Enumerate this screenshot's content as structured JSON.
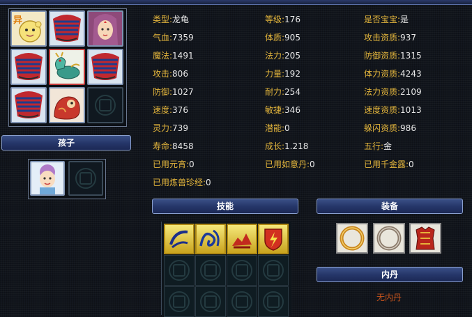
{
  "pets_header": "孩子",
  "pet_grid": {
    "badge": "异"
  },
  "stats": {
    "col1": [
      {
        "label": "类型:",
        "value": "龙龟"
      },
      {
        "label": "气血:",
        "value": "7359"
      },
      {
        "label": "魔法:",
        "value": "1491"
      },
      {
        "label": "攻击:",
        "value": "806"
      },
      {
        "label": "防御:",
        "value": "1027"
      },
      {
        "label": "速度:",
        "value": "376"
      },
      {
        "label": "灵力:",
        "value": "739"
      },
      {
        "label": "寿命:",
        "value": "8458"
      },
      {
        "label": "已用元宵:",
        "value": "0"
      },
      {
        "label": "已用炼兽珍经:",
        "value": "0"
      }
    ],
    "col2": [
      {
        "label": "等级:",
        "value": "176"
      },
      {
        "label": "体质:",
        "value": "905"
      },
      {
        "label": "法力:",
        "value": "205"
      },
      {
        "label": "力量:",
        "value": "192"
      },
      {
        "label": "耐力:",
        "value": "254"
      },
      {
        "label": "敏捷:",
        "value": "346"
      },
      {
        "label": "潜能:",
        "value": "0"
      },
      {
        "label": "成长:",
        "value": "1.218"
      },
      {
        "label": "已用如意丹:",
        "value": "0"
      }
    ],
    "col3": [
      {
        "label": "是否宝宝:",
        "value": "是"
      },
      {
        "label": "攻击资质:",
        "value": "937"
      },
      {
        "label": "防御资质:",
        "value": "1315"
      },
      {
        "label": "体力资质:",
        "value": "4243"
      },
      {
        "label": "法力资质:",
        "value": "2109"
      },
      {
        "label": "速度资质:",
        "value": "1013"
      },
      {
        "label": "躲闪资质:",
        "value": "986"
      },
      {
        "label": "五行:",
        "value": "金"
      },
      {
        "label": "已用千金露:",
        "value": "0"
      }
    ]
  },
  "skills_header": "技能",
  "equip_header": "装备",
  "neidan_header": "内丹",
  "neidan_empty": "无内丹",
  "colors": {
    "label": "#e3b53c",
    "value": "#e8e8e8",
    "neidan": "#c8541c"
  }
}
